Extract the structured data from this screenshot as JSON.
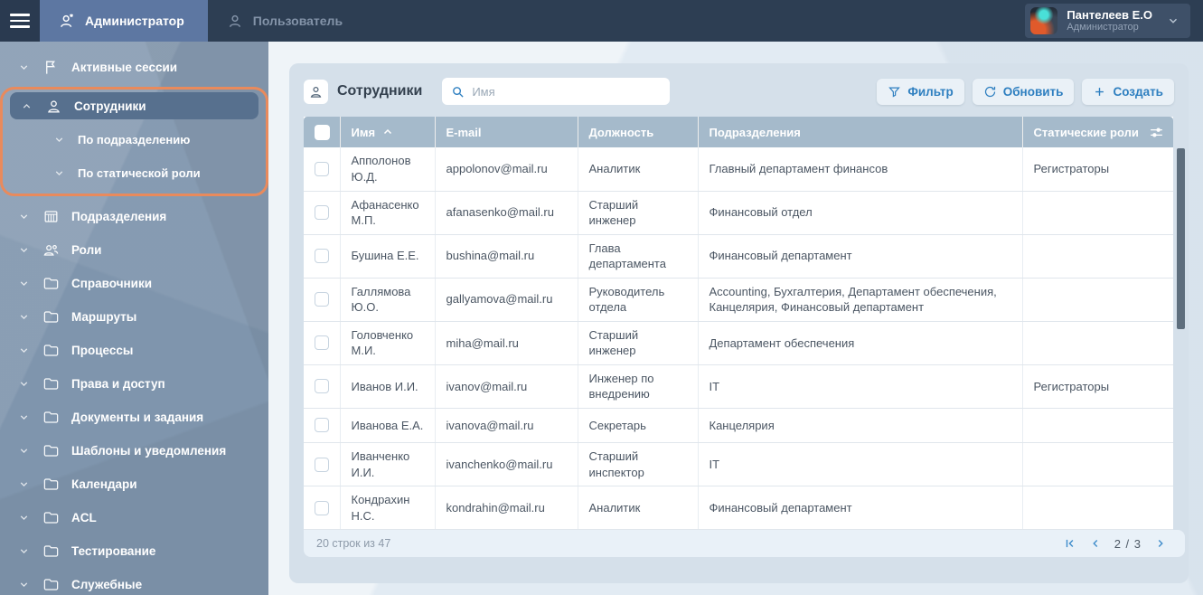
{
  "colors": {
    "topbar": "#2d3e53",
    "activeTab": "#5d77a2",
    "sidebar": "#7f95ad",
    "selected": "#57708e",
    "accent": "#e98a5c",
    "blue": "#2e7fc0",
    "thead": "#a5bacb"
  },
  "topbar": {
    "tabs": [
      {
        "label": "Администратор",
        "active": true
      },
      {
        "label": "Пользователь",
        "active": false
      }
    ],
    "user": {
      "name": "Пантелеев Е.О",
      "role": "Администратор"
    }
  },
  "sidebar": {
    "items": [
      {
        "label": "Активные сессии",
        "icon": "flag-icon"
      },
      {
        "label": "Сотрудники",
        "icon": "person-icon",
        "selected": true,
        "children": [
          {
            "label": "По подразделению"
          },
          {
            "label": "По статической роли"
          }
        ]
      },
      {
        "label": "Подразделения",
        "icon": "departments-icon"
      },
      {
        "label": "Роли",
        "icon": "roles-icon"
      },
      {
        "label": "Справочники",
        "icon": "folder-icon"
      },
      {
        "label": "Маршруты",
        "icon": "folder-icon"
      },
      {
        "label": "Процессы",
        "icon": "folder-icon"
      },
      {
        "label": "Права и доступ",
        "icon": "folder-icon"
      },
      {
        "label": "Документы и задания",
        "icon": "folder-icon"
      },
      {
        "label": "Шаблоны и уведомления",
        "icon": "folder-icon"
      },
      {
        "label": "Календари",
        "icon": "folder-icon"
      },
      {
        "label": "ACL",
        "icon": "folder-icon"
      },
      {
        "label": "Тестирование",
        "icon": "folder-icon"
      },
      {
        "label": "Служебные",
        "icon": "folder-icon"
      }
    ]
  },
  "main": {
    "title": "Сотрудники",
    "search": {
      "placeholder": "Имя",
      "value": ""
    },
    "buttons": {
      "filter": "Фильтр",
      "refresh": "Обновить",
      "create": "Создать"
    },
    "table": {
      "columns": [
        "Имя",
        "E-mail",
        "Должность",
        "Подразделения",
        "Статические роли"
      ],
      "sorted_column": "Имя",
      "sort_direction": "asc",
      "rows": [
        {
          "name": "Апполонов Ю.Д.",
          "email": "appolonov@mail.ru",
          "position": "Аналитик",
          "departments": "Главный департамент финансов",
          "roles": "Регистраторы"
        },
        {
          "name": "Афанасенко М.П.",
          "email": "afanasenko@mail.ru",
          "position": "Старший инженер",
          "departments": "Финансовый отдел",
          "roles": ""
        },
        {
          "name": "Бушина Е.Е.",
          "email": "bushina@mail.ru",
          "position": "Глава департамента",
          "departments": "Финансовый департамент",
          "roles": ""
        },
        {
          "name": "Галлямова Ю.О.",
          "email": "gallyamova@mail.ru",
          "position": "Руководитель отдела",
          "departments": "Accounting, Бухгалтерия, Департамент обеспечения, Канцелярия, Финансовый департамент",
          "roles": ""
        },
        {
          "name": "Головченко М.И.",
          "email": "miha@mail.ru",
          "position": "Старший инженер",
          "departments": "Департамент обеспечения",
          "roles": ""
        },
        {
          "name": "Иванов И.И.",
          "email": "ivanov@mail.ru",
          "position": "Инженер по внедрению",
          "departments": "IT",
          "roles": "Регистраторы"
        },
        {
          "name": "Иванова Е.А.",
          "email": "ivanova@mail.ru",
          "position": "Секретарь",
          "departments": "Канцелярия",
          "roles": ""
        },
        {
          "name": "Иванченко И.И.",
          "email": "ivanchenko@mail.ru",
          "position": "Старший инспектор",
          "departments": "IT",
          "roles": ""
        },
        {
          "name": "Кондрахин Н.С.",
          "email": "kondrahin@mail.ru",
          "position": "Аналитик",
          "departments": "Финансовый департамент",
          "roles": ""
        }
      ],
      "footer": {
        "rows_info": "20 строк из 47",
        "page": "2 / 3"
      }
    }
  }
}
